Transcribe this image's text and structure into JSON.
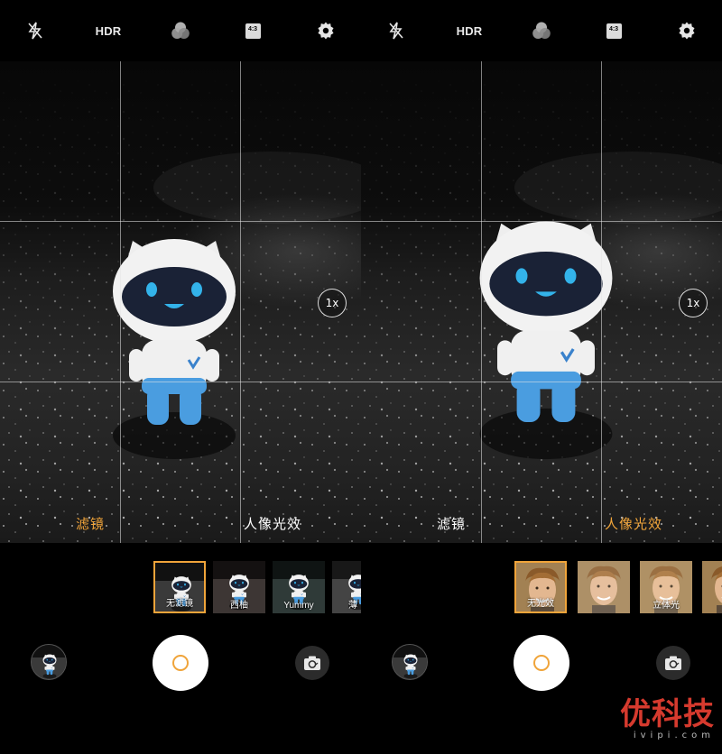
{
  "toolbar": {
    "icons": [
      "flash-off-icon",
      "filters-icon",
      "aspect-ratio-icon",
      "settings-icon"
    ],
    "hdr_label": "HDR",
    "ratio_label": "4:3"
  },
  "viewfinder": {
    "zoom_label": "1x"
  },
  "left_panel": {
    "tabs": [
      {
        "label": "滤镜",
        "active": true
      },
      {
        "label": "人像光效",
        "active": false
      }
    ],
    "filters": [
      {
        "label": "无滤镜",
        "selected": true
      },
      {
        "label": "西柚",
        "selected": false
      },
      {
        "label": "Yummy",
        "selected": false
      },
      {
        "label": "薄",
        "selected": false
      }
    ]
  },
  "right_panel": {
    "tabs": [
      {
        "label": "滤镜",
        "active": false
      },
      {
        "label": "人像光效",
        "active": true
      }
    ],
    "light_effects": [
      {
        "label": "无光效",
        "selected": true
      },
      {
        "label": "",
        "selected": false
      },
      {
        "label": "立体光",
        "selected": false
      },
      {
        "label": "",
        "selected": false
      }
    ]
  },
  "controls": {
    "gallery_icon": "gallery-thumbnail",
    "shutter_icon": "shutter-icon",
    "switch_icon": "camera-switch-icon"
  },
  "watermark": {
    "logo": [
      "优",
      "科",
      "技"
    ],
    "domain": "ivipi.com"
  },
  "colors": {
    "accent": "#f0a43a",
    "watermark": "#d63a2e",
    "mascot_body": "#f2f2f2",
    "mascot_face": "#1a2236",
    "mascot_eyes": "#33b3ea",
    "mascot_legs": "#4a9de0"
  }
}
